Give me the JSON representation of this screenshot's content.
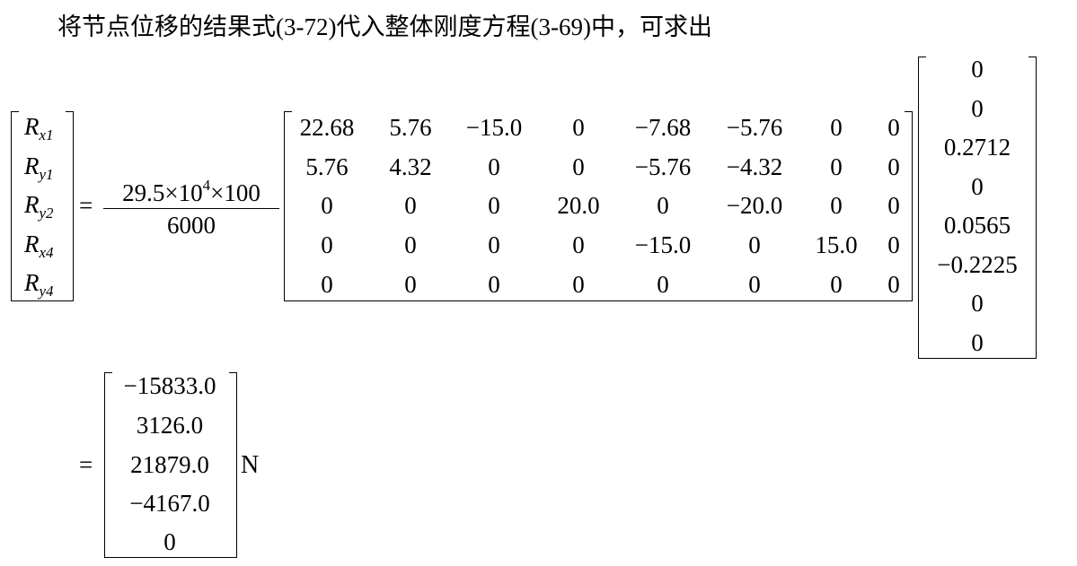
{
  "intro": {
    "prefix": "将节点位移的结果式",
    "ref1": "(3-72)",
    "middle": "代入整体刚度方程",
    "ref2": "(3-69)",
    "suffix": "中，可求出"
  },
  "equation": {
    "lhs": [
      {
        "symbol": "R",
        "sub": "x1"
      },
      {
        "symbol": "R",
        "sub": "y1"
      },
      {
        "symbol": "R",
        "sub": "y2"
      },
      {
        "symbol": "R",
        "sub": "x4"
      },
      {
        "symbol": "R",
        "sub": "y4"
      }
    ],
    "equals": "=",
    "fraction": {
      "num_a": "29.5",
      "times1": "×",
      "num_b": "10",
      "exp": "4",
      "times2": "×",
      "num_c": "100",
      "den": "6000"
    },
    "matrix": [
      [
        "22.68",
        "5.76",
        "−15.0",
        "0",
        "−7.68",
        "−5.76",
        "0",
        "0"
      ],
      [
        "5.76",
        "4.32",
        "0",
        "0",
        "−5.76",
        "−4.32",
        "0",
        "0"
      ],
      [
        "0",
        "0",
        "0",
        "20.0",
        "0",
        "−20.0",
        "0",
        "0"
      ],
      [
        "0",
        "0",
        "0",
        "0",
        "−15.0",
        "0",
        "15.0",
        "0"
      ],
      [
        "0",
        "0",
        "0",
        "0",
        "0",
        "0",
        "0",
        "0"
      ]
    ],
    "displacements": [
      "0",
      "0",
      "0.2712",
      "0",
      "0.0565",
      "−0.2225",
      "0",
      "0"
    ],
    "result": [
      "−15833.0",
      "3126.0",
      "21879.0",
      "−4167.0",
      "0"
    ],
    "unit": "N"
  }
}
